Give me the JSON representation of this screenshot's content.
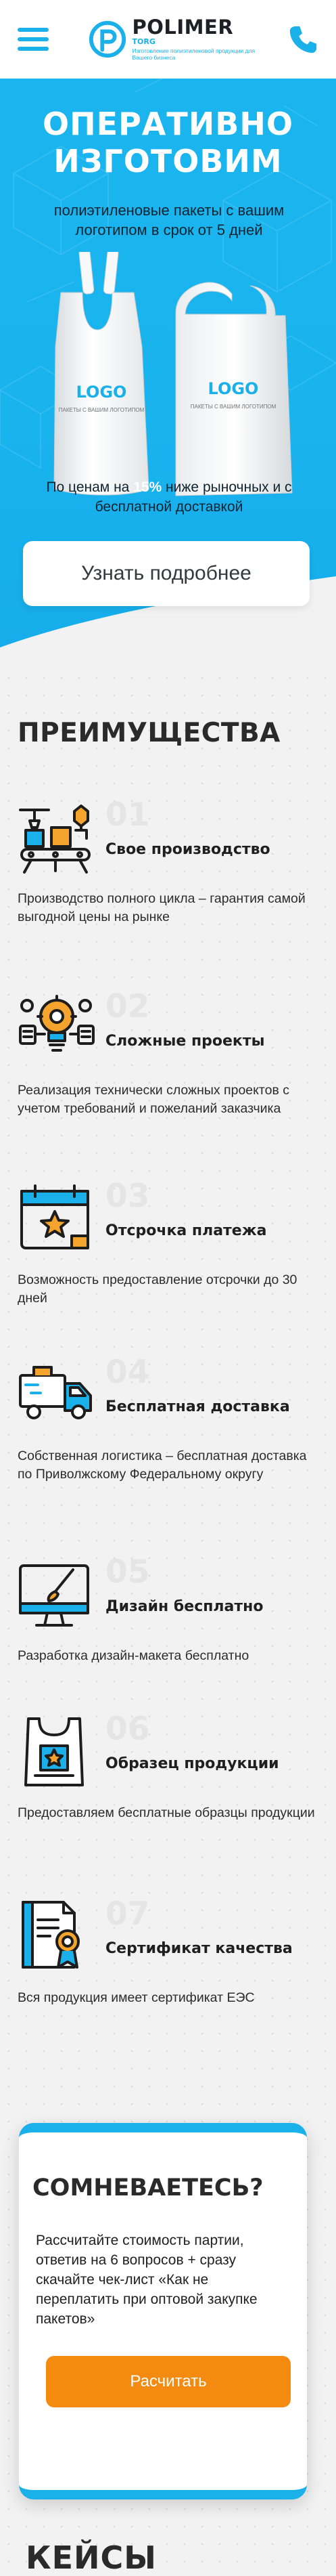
{
  "header": {
    "logo_name": "POLIMER",
    "logo_sub": "TORG",
    "logo_tagline": "Изготовление полиэтиленовой продукции для Вашего бизнеса"
  },
  "hero": {
    "title_line1": "ОПЕРАТИВНО",
    "title_line2": "ИЗГОТОВИМ",
    "subtitle": "полиэтиленовые пакеты с вашим логотипом в срок от 5 дней",
    "bag_logo": "LOGO",
    "bag_caption": "ПАКЕТЫ С ВАШИМ ЛОГОТИПОМ",
    "price_before": "По ценам на ",
    "price_pct": "15%",
    "price_after": " ниже рыночных и с бесплатной доставкой",
    "button": "Узнать подробнее"
  },
  "advantages": {
    "title": "ПРЕИМУЩЕСТВА",
    "items": [
      {
        "num": "01",
        "head": "Свое производство",
        "text": "Производство полного цикла – гарантия самой выгодной цены на рынке",
        "icon": "conveyor-icon"
      },
      {
        "num": "02",
        "head": "Сложные проекты",
        "text": "Реализация технически сложных проектов с учетом требований и пожеланий заказчика",
        "icon": "lightbulb-gear-icon"
      },
      {
        "num": "03",
        "head": "Отсрочка платежа",
        "text": "Возможность предоставление отсрочки до 30 дней",
        "icon": "calendar-star-icon"
      },
      {
        "num": "04",
        "head": "Бесплатная доставка",
        "text": "Собственная логистика – бесплатная доставка по Приволжскому Федеральному округу",
        "icon": "delivery-truck-icon"
      },
      {
        "num": "05",
        "head": "Дизайн бесплатно",
        "text": "Разработка дизайн-макета бесплатно",
        "icon": "monitor-brush-icon"
      },
      {
        "num": "06",
        "head": "Образец продукции",
        "text": "Предоставляем бесплатные образцы продукции",
        "icon": "sample-bag-icon"
      },
      {
        "num": "07",
        "head": "Сертификат качества",
        "text": "Вся продукция имеет сертификат ЕЭС",
        "icon": "certificate-icon"
      }
    ]
  },
  "doubt": {
    "title": "СОМНЕВАЕТЕСЬ?",
    "text": "Рассчитайте стоимость партии, ответив на 6 вопросов + сразу скачайте чек-лист «Как не переплатить при оптовой закупке пакетов»",
    "button": "Расчитать"
  },
  "cases": {
    "title": "КЕЙСЫ"
  },
  "colors": {
    "brand_blue": "#1ab0ea",
    "accent_orange": "#f58a10",
    "icon_accent": "#f4a42c"
  }
}
